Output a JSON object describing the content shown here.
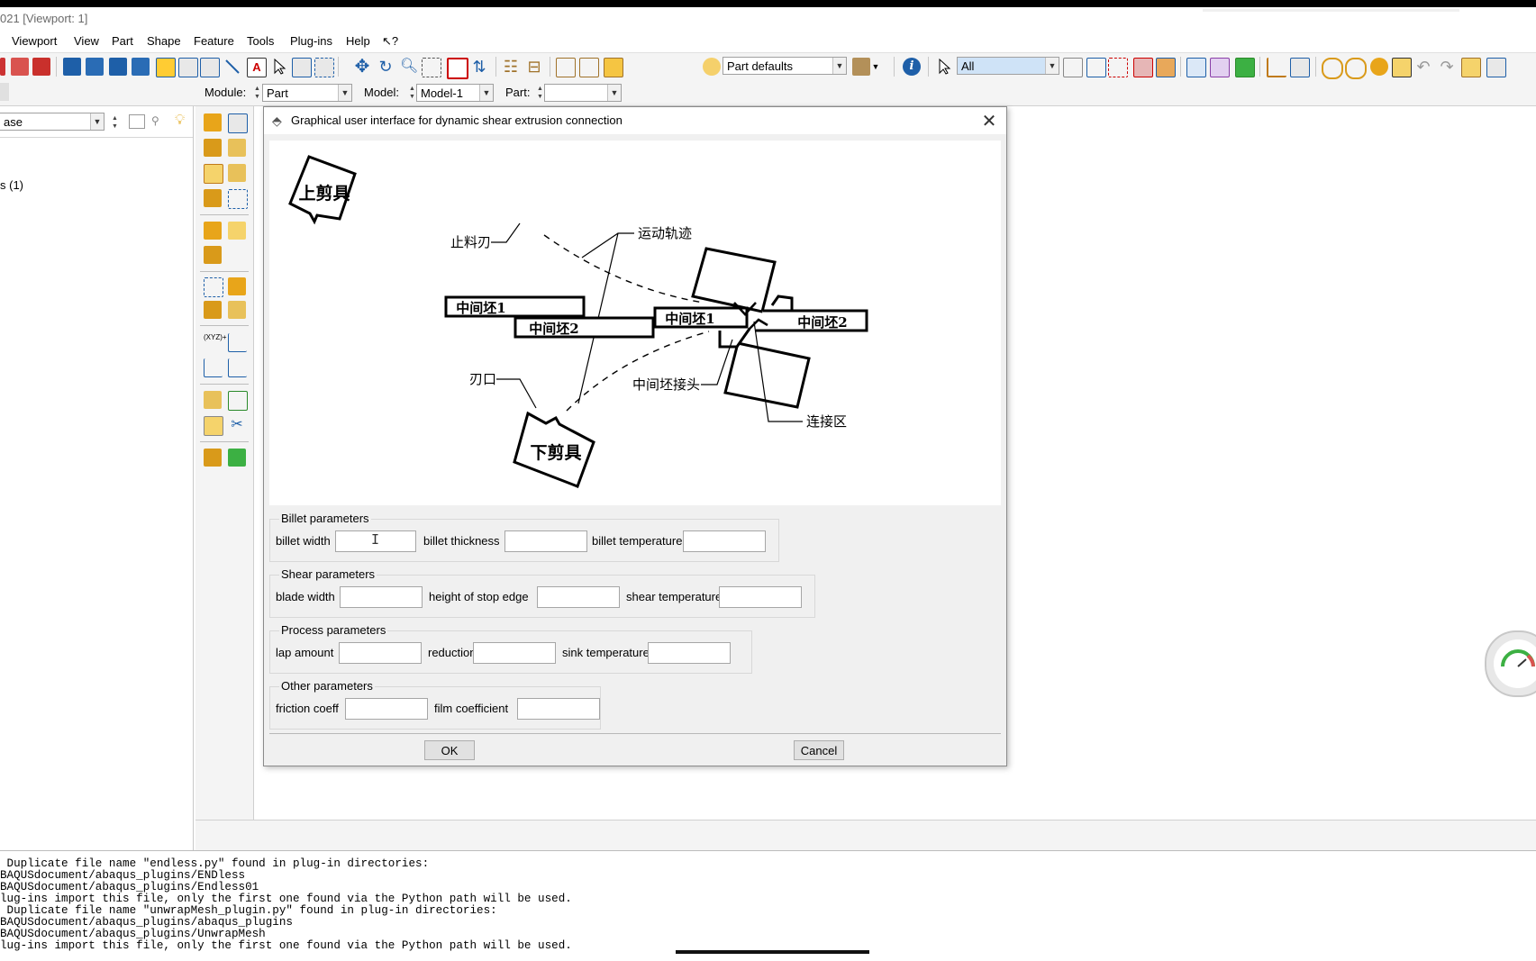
{
  "window": {
    "title": "021 [Viewport: 1]"
  },
  "menu": [
    "Viewport",
    "View",
    "Part",
    "Shape",
    "Feature",
    "Tools",
    "Plug-ins",
    "Help",
    "↖?"
  ],
  "toolbar": {
    "part_defaults": "Part defaults",
    "selection_filter": "All"
  },
  "context_bar": {
    "module_label": "Module:",
    "module_value": "Part",
    "model_label": "Model:",
    "model_value": "Model-1",
    "part_label": "Part:",
    "part_value": ""
  },
  "model_tree": {
    "combo_value": "ase",
    "item": "s (1)"
  },
  "dialog": {
    "title": "Graphical user interface for dynamic shear extrusion connection",
    "diagram_labels": {
      "upper_shear": "上剪具",
      "lower_shear": "下剪具",
      "stop_blade": "止料刃",
      "trajectory": "运动轨迹",
      "billet1": "中间坯1",
      "billet2": "中间坯2",
      "billet1_right": "中间坯1",
      "billet2_right": "中间坯2",
      "blade_edge": "刃口",
      "joint": "中间坯接头",
      "connection_zone": "连接区"
    },
    "billet": {
      "title": "Billet parameters",
      "width_label": "billet width",
      "width_value": "",
      "thickness_label": "billet thickness",
      "thickness_value": "",
      "temperature_label": "billet temperature",
      "temperature_value": ""
    },
    "shear": {
      "title": "Shear parameters",
      "blade_width_label": "blade width",
      "blade_width_value": "",
      "stop_edge_label": "height of stop edge",
      "stop_edge_value": "",
      "temperature_label": "shear temperature",
      "temperature_value": ""
    },
    "process": {
      "title": "Process parameters",
      "lap_label": "lap amount",
      "lap_value": "",
      "reduction_label": "reduction",
      "reduction_value": "",
      "sink_label": "sink temperature",
      "sink_value": ""
    },
    "other": {
      "title": "Other parameters",
      "friction_label": "friction coeff",
      "friction_value": "",
      "film_label": "film coefficient",
      "film_value": ""
    },
    "ok_label": "OK",
    "cancel_label": "Cancel"
  },
  "console": {
    "lines": [
      " Duplicate file name \"endless.py\" found in plug-in directories:",
      "BAQUSdocument/abaqus_plugins/ENDless",
      "BAQUSdocument/abaqus_plugins/Endless01",
      "lug-ins import this file, only the first one found via the Python path will be used.",
      " Duplicate file name \"unwrapMesh_plugin.py\" found in plug-in directories:",
      "BAQUSdocument/abaqus_plugins/abaqus_plugins",
      "BAQUSdocument/abaqus_plugins/UnwrapMesh",
      "lug-ins import this file, only the first one found via the Python path will be used."
    ]
  }
}
